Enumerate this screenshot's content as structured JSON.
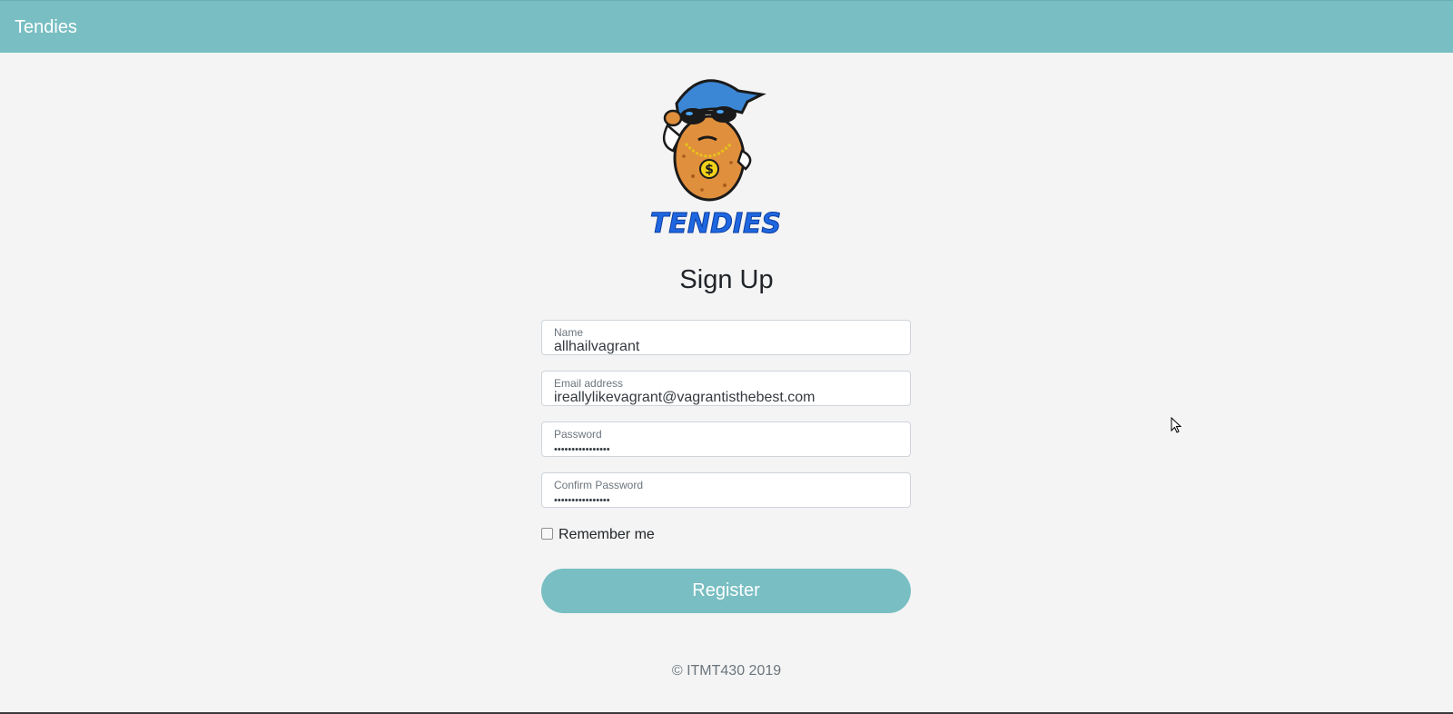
{
  "navbar": {
    "brand": "Tendies",
    "color": "#78bec2"
  },
  "logo": {
    "name": "tendies-mascot-logo",
    "wordmark": "TENDIES"
  },
  "form": {
    "title": "Sign Up",
    "fields": {
      "name": {
        "label": "Name",
        "value": "allhailvagrant"
      },
      "email": {
        "label": "Email address",
        "value": "ireallylikevagrant@vagrantisthebest.com"
      },
      "password": {
        "label": "Password",
        "value": "••••••••••••••••"
      },
      "confirm_password": {
        "label": "Confirm Password",
        "value": "••••••••••••••••"
      }
    },
    "remember": {
      "label": "Remember me",
      "checked": false
    },
    "submit_label": "Register"
  },
  "footer": {
    "text": "© ITMT430 2019"
  },
  "icons": {
    "cursor": "mouse-pointer-icon"
  }
}
